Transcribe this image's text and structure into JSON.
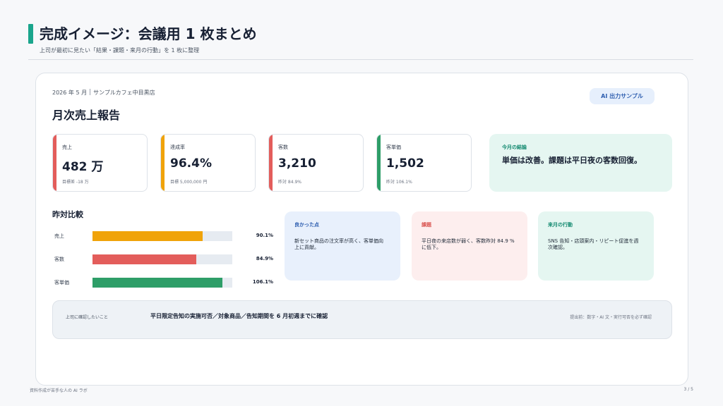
{
  "header": {
    "title": "完成イメージ：会議用 1 枚まとめ",
    "subtitle": "上司が最初に見たい「結果・課題・来月の行動」を 1 枚に整理"
  },
  "report": {
    "period": "2026 年 5 月",
    "store": "サンプルカフェ中目黒店",
    "title": "月次売上報告",
    "badge": "AI 出力サンプル"
  },
  "kpis": [
    {
      "label": "売上",
      "value": "482 万",
      "note": "目標差 -18 万",
      "color": "#e35d5b"
    },
    {
      "label": "達成率",
      "value": "96.4%",
      "note": "目標 5,000,000 円",
      "color": "#f0a30a"
    },
    {
      "label": "客数",
      "value": "3,210",
      "note": "昨対 84.9%",
      "color": "#e35d5b"
    },
    {
      "label": "客単価",
      "value": "1,502",
      "note": "昨対 106.1%",
      "color": "#2e9e68"
    }
  ],
  "conclusion": {
    "label": "今月の結論",
    "text": "単価は改善。課題は平日夜の客数回復。"
  },
  "comparison": {
    "title": "昨対比較",
    "rows": [
      {
        "label": "売上",
        "pct_text": "90.1%",
        "fill": 0.787,
        "color": "#f0a30a"
      },
      {
        "label": "客数",
        "pct_text": "84.9%",
        "fill": 0.742,
        "color": "#e35d5b"
      },
      {
        "label": "客単価",
        "pct_text": "106.1%",
        "fill": 0.927,
        "color": "#2e9e68"
      }
    ]
  },
  "notes": [
    {
      "title": "良かった点",
      "text": "新セット商品の注文率が高く、客単価向上に貢献。",
      "bg": "#e8f0fc",
      "title_color": "#2f5fb0"
    },
    {
      "title": "課題",
      "text": "平日夜の来店数が弱く、客数昨対 84.9 %に低下。",
      "bg": "#fdeeee",
      "title_color": "#d9534f"
    },
    {
      "title": "来月の行動",
      "text": "SNS 告知・店頭案内・リピート促進を週次確認。",
      "bg": "#e5f6f1",
      "title_color": "#138a70"
    }
  ],
  "confirm": {
    "label": "上司に確認したいこと",
    "main": "平日限定告知の実施可否／対象商品／告知期間を 6 月初週までに確認",
    "right": "提出前：数字・AI 文・実行可否を必ず確認"
  },
  "footer": {
    "left": "資料作成が苦手な人の AI ラボ",
    "page": "3 / 5"
  }
}
